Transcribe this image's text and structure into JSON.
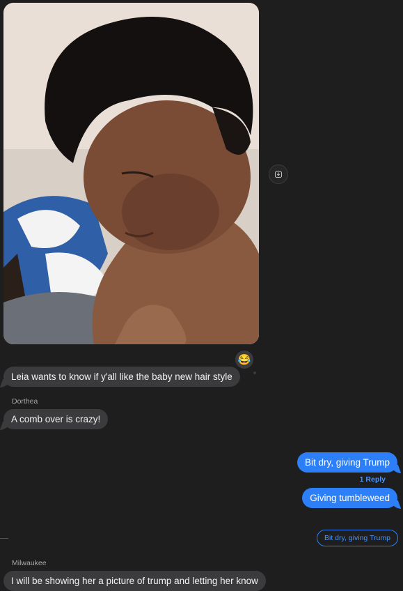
{
  "messages": {
    "m1": {
      "text": "Leia wants to know if y'all like the baby new hair style"
    },
    "m2": {
      "sender": "Dorthea",
      "text": "A comb over is crazy!"
    },
    "m3": {
      "text": "Bit dry, giving Trump",
      "replies": "1 Reply"
    },
    "m4": {
      "text": "Giving tumbleweed"
    },
    "reply_chip": {
      "text": "Bit dry, giving Trump"
    },
    "m5": {
      "sender": "Milwaukee",
      "text": "I will be showing her a picture of trump and letting her know"
    }
  },
  "icons": {
    "save": "download-icon",
    "tapback": "laughing-emoji-icon",
    "tapback_glyph": "😂"
  },
  "colors": {
    "background": "#1e1e1e",
    "incoming_bubble": "#3b3b3d",
    "outgoing_bubble": "#2d7ff7",
    "link": "#4c94f7"
  }
}
